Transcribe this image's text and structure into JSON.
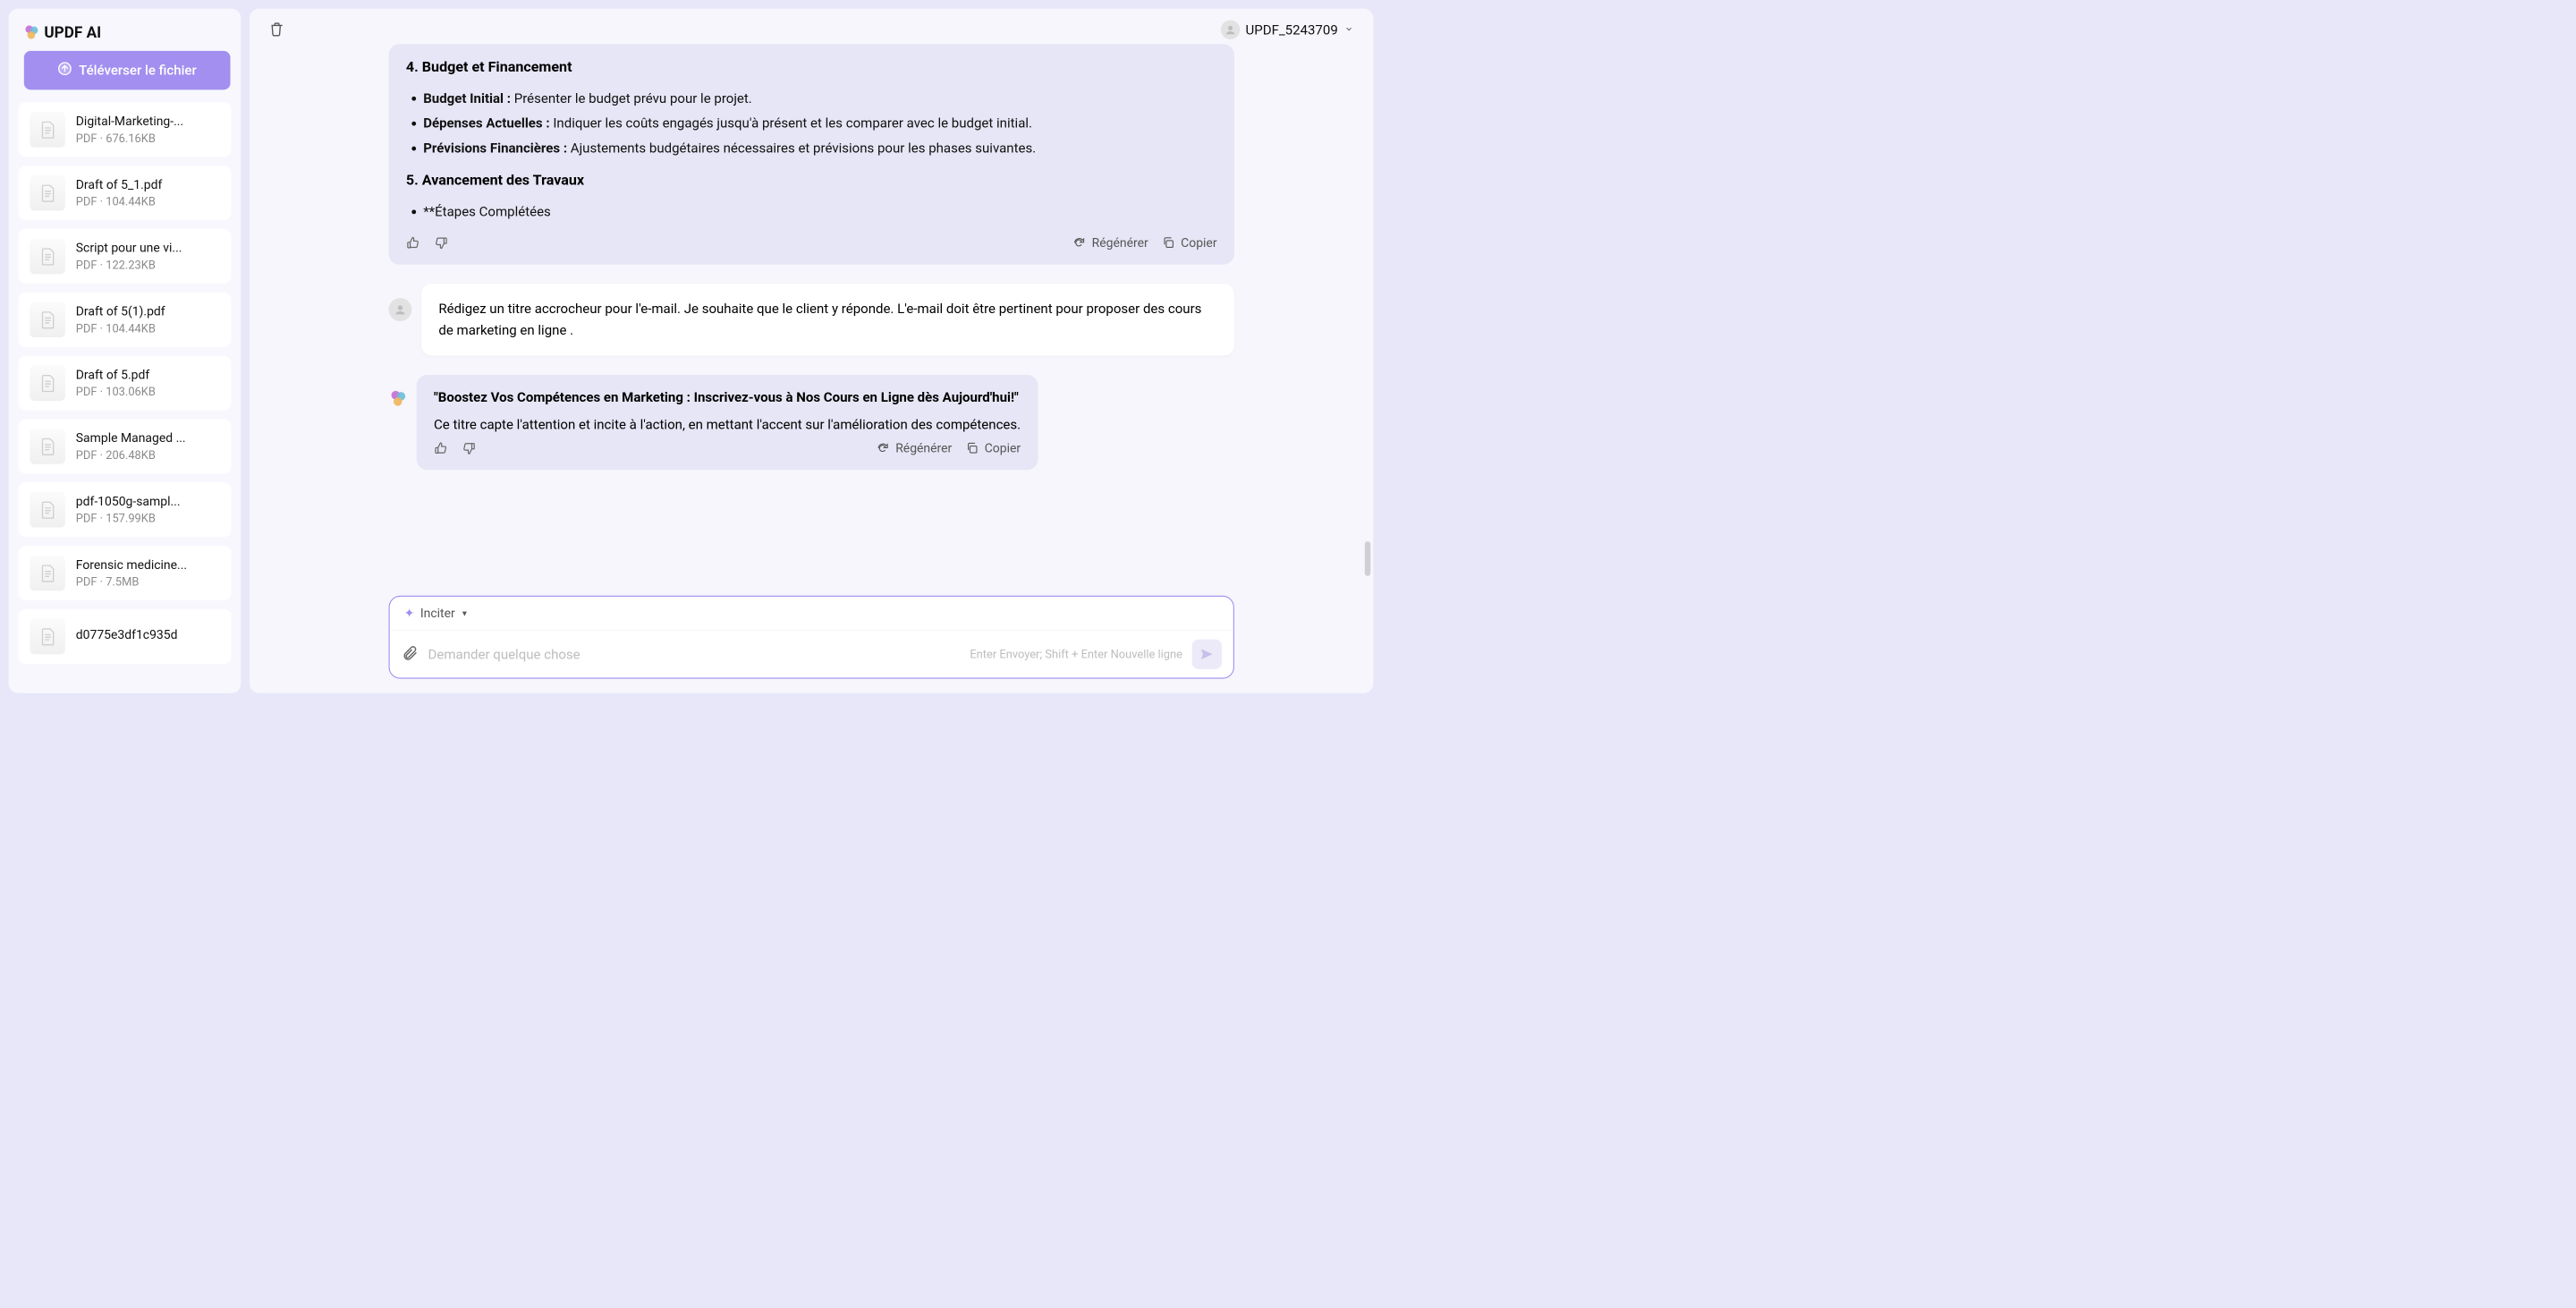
{
  "app_title": "UPDF AI",
  "upload_label": "Téléverser le fichier",
  "username": "UPDF_5243709",
  "files": [
    {
      "name": "Digital-Marketing-...",
      "meta": "PDF · 676.16KB"
    },
    {
      "name": "Draft of 5_1.pdf",
      "meta": "PDF · 104.44KB"
    },
    {
      "name": "Script pour une vi...",
      "meta": "PDF · 122.23KB"
    },
    {
      "name": "Draft of 5(1).pdf",
      "meta": "PDF · 104.44KB"
    },
    {
      "name": "Draft of 5.pdf",
      "meta": "PDF · 103.06KB"
    },
    {
      "name": "Sample Managed ...",
      "meta": "PDF · 206.48KB"
    },
    {
      "name": "pdf-1050g-sampl...",
      "meta": "PDF · 157.99KB"
    },
    {
      "name": "Forensic medicine...",
      "meta": "PDF · 7.5MB"
    },
    {
      "name": "d0775e3df1c935d",
      "meta": ""
    }
  ],
  "msg1": {
    "h4": "4. Budget et Financement",
    "li1_b": "Budget Initial :",
    "li1_t": " Présenter le budget prévu pour le projet.",
    "li2_b": "Dépenses Actuelles :",
    "li2_t": " Indiquer les coûts engagés jusqu'à présent et les comparer avec le budget initial.",
    "li3_b": "Prévisions Financières :",
    "li3_t": " Ajustements budgétaires nécessaires et prévisions pour les phases suivantes.",
    "h5": "5. Avancement des Travaux",
    "li4": "**Étapes Complétées"
  },
  "actions": {
    "regenerate": "Régénérer",
    "copy": "Copier"
  },
  "user_prompt": "Rédigez un titre accrocheur pour l'e-mail. Je souhaite que le client y réponde. L'e-mail doit être pertinent pour proposer des cours de marketing en ligne .",
  "msg2": {
    "title": "\"Boostez Vos Compétences en Marketing : Inscrivez-vous à Nos Cours en Ligne dès Aujourd'hui!\"",
    "body": "Ce titre capte l'attention et incite à l'action, en mettant l'accent sur l'amélioration des compétences."
  },
  "composer": {
    "mode_label": "Inciter",
    "placeholder": "Demander quelque chose",
    "hint": "Enter Envoyer; Shift + Enter Nouvelle ligne"
  }
}
